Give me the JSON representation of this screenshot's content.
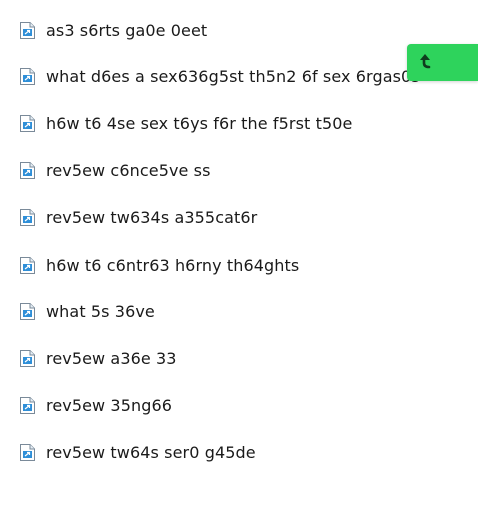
{
  "links": [
    {
      "label": "as3 s6rts ga0e 0eet",
      "icon": "document-link-icon"
    },
    {
      "label": "what d6es a sex636g5st th5n2 6f sex 6rgas0s",
      "icon": "document-link-icon"
    },
    {
      "label": "h6w t6 4se sex t6ys f6r the f5rst t50e",
      "icon": "document-link-icon"
    },
    {
      "label": "rev5ew c6nce5ve ss",
      "icon": "document-link-icon"
    },
    {
      "label": "rev5ew tw634s a355cat6r",
      "icon": "document-link-icon"
    },
    {
      "label": "h6w t6 c6ntr63 h6rny th64ghts",
      "icon": "document-link-icon"
    },
    {
      "label": "what 5s 36ve",
      "icon": "document-link-icon"
    },
    {
      "label": "rev5ew a36e 33",
      "icon": "document-link-icon"
    },
    {
      "label": "rev5ew 35ng66",
      "icon": "document-link-icon"
    },
    {
      "label": "rev5ew tw64s ser0 g45de",
      "icon": "document-link-icon"
    }
  ],
  "floating_button": {
    "icon": "back-arrow-icon",
    "color": "#2ed35c"
  },
  "colors": {
    "icon_blue": "#2f8fd8",
    "text": "#1a1a1a"
  }
}
